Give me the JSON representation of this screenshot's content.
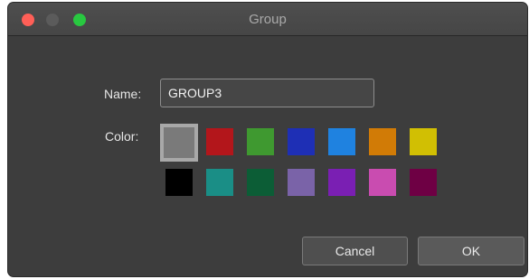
{
  "window": {
    "title": "Group",
    "traffic_lights": {
      "close_color": "#ff5f57",
      "minimize_color": "#5b5b5b",
      "zoom_color": "#28c840"
    }
  },
  "form": {
    "name_label": "Name:",
    "name_value": "GROUP3",
    "color_label": "Color:",
    "selected_color": "#7a7a7a",
    "colors": [
      "#7a7a7a",
      "#b3161b",
      "#3f9930",
      "#1e2fb5",
      "#1f82e0",
      "#d17b06",
      "#d1bf03",
      "#000000",
      "#1a8e86",
      "#0c5d36",
      "#7a63a8",
      "#7a1fb3",
      "#c94cb0",
      "#6e0044"
    ]
  },
  "buttons": {
    "cancel": "Cancel",
    "ok": "OK"
  }
}
